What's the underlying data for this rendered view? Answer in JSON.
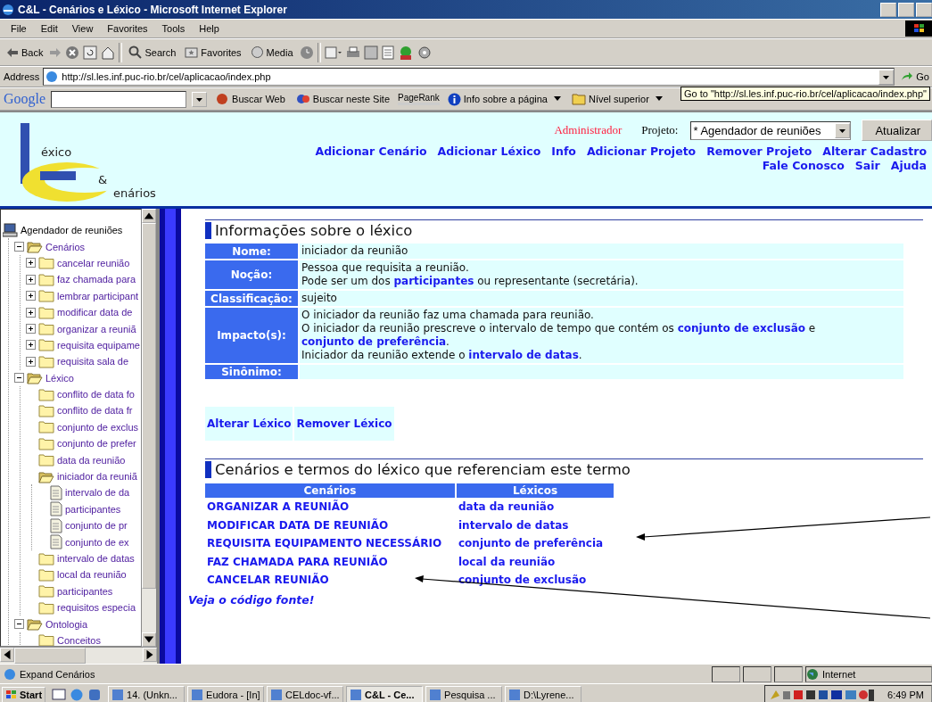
{
  "window": {
    "title": "C&L - Cenários e Léxico - Microsoft Internet Explorer"
  },
  "menu": [
    "File",
    "Edit",
    "View",
    "Favorites",
    "Tools",
    "Help"
  ],
  "toolbar": {
    "back": "Back",
    "search": "Search",
    "favorites": "Favorites",
    "media": "Media"
  },
  "address_bar": {
    "label": "Address",
    "url": "http://sl.les.inf.puc-rio.br/cel/aplicacao/index.php",
    "go": "Go"
  },
  "google_bar": {
    "logo": "Google",
    "buscar_web": "Buscar Web",
    "buscar_site": "Buscar neste Site",
    "pagerank": "PageRank",
    "info": "Info sobre a página",
    "nivel": "Nível superior"
  },
  "tooltip": "Go to \"http://sl.les.inf.puc-rio.br/cel/aplicacao/index.php\"",
  "header": {
    "logo": {
      "line1": "éxico",
      "amp": "&",
      "line2": "enários"
    },
    "role": "Administrador",
    "project_label": "Projeto:",
    "project": "* Agendador de reuniões",
    "update_button": "Atualizar",
    "nav": [
      [
        "Adicionar Cenário",
        "Adicionar Léxico",
        "Info",
        "Adicionar Projeto",
        "Remover Projeto",
        "Alterar Cadastro"
      ],
      [
        "Fale Conosco",
        "Sair",
        "Ajuda"
      ]
    ]
  },
  "tree": {
    "label": "Agendador de reuniões",
    "kind": "computer",
    "children": [
      {
        "label": "Cenários",
        "kind": "folder",
        "expanded": true,
        "children": [
          {
            "label": "cancelar reunião",
            "kind": "folder",
            "expanded": false
          },
          {
            "label": "faz chamada para",
            "kind": "folder",
            "expanded": false
          },
          {
            "label": "lembrar participant",
            "kind": "folder",
            "expanded": false
          },
          {
            "label": "modificar data de",
            "kind": "folder",
            "expanded": false
          },
          {
            "label": "organizar a reuniã",
            "kind": "folder",
            "expanded": false
          },
          {
            "label": "requisita equipame",
            "kind": "folder",
            "expanded": false
          },
          {
            "label": "requisita sala de",
            "kind": "folder",
            "expanded": false
          }
        ]
      },
      {
        "label": "Léxico",
        "kind": "folder",
        "expanded": true,
        "children": [
          {
            "label": "conflito de data fo",
            "kind": "folder"
          },
          {
            "label": "conflito de data fr",
            "kind": "folder"
          },
          {
            "label": "conjunto de exclus",
            "kind": "folder"
          },
          {
            "label": "conjunto de prefer",
            "kind": "folder"
          },
          {
            "label": "data da reunião",
            "kind": "folder"
          },
          {
            "label": "iniciador da reuniã",
            "kind": "folder",
            "children": [
              {
                "label": "intervalo de da",
                "kind": "document"
              },
              {
                "label": "participantes",
                "kind": "document"
              },
              {
                "label": "conjunto de pr",
                "kind": "document"
              },
              {
                "label": "conjunto de ex",
                "kind": "document"
              }
            ]
          },
          {
            "label": "intervalo de datas",
            "kind": "folder"
          },
          {
            "label": "local da reunião",
            "kind": "folder"
          },
          {
            "label": "participantes",
            "kind": "folder"
          },
          {
            "label": "requisitos especia",
            "kind": "folder"
          }
        ]
      },
      {
        "label": "Ontologia",
        "kind": "folder",
        "expanded": true,
        "children": [
          {
            "label": "Conceitos",
            "kind": "folder"
          }
        ]
      }
    ]
  },
  "lexicon": {
    "heading": "Informações sobre o léxico",
    "fields": [
      {
        "label": "Nome:",
        "lines": [
          [
            {
              "text": "iniciador da reunião",
              "link": false
            }
          ]
        ]
      },
      {
        "label": "Noção:",
        "lines": [
          [
            {
              "text": "Pessoa que requisita a reunião.",
              "link": false
            }
          ],
          [
            {
              "text": "Pode ser um dos ",
              "link": false
            },
            {
              "text": "participantes",
              "link": true
            },
            {
              "text": " ou representante (secretária).",
              "link": false
            }
          ]
        ]
      },
      {
        "label": "Classificação:",
        "lines": [
          [
            {
              "text": "sujeito",
              "link": false
            }
          ]
        ]
      },
      {
        "label": "Impacto(s):",
        "lines": [
          [
            {
              "text": "O iniciador da reunião faz uma chamada para reunião.",
              "link": false
            }
          ],
          [
            {
              "text": "O iniciador da reunião prescreve o intervalo de tempo que contém os ",
              "link": false
            },
            {
              "text": "conjunto de exclusão",
              "link": true
            },
            {
              "text": " e ",
              "link": false
            },
            {
              "text": "conjunto de preferência",
              "link": true
            },
            {
              "text": ".",
              "link": false
            }
          ],
          [
            {
              "text": "Iniciador da reunião extende o ",
              "link": false
            },
            {
              "text": "intervalo de datas",
              "link": true
            },
            {
              "text": ".",
              "link": false
            }
          ]
        ]
      },
      {
        "label": "Sinônimo:"
      }
    ],
    "actions": [
      "Alterar Léxico",
      "Remover Léxico"
    ]
  },
  "references": {
    "heading": "Cenários e termos do léxico que referenciam este termo",
    "columns": [
      "Cenários",
      "Léxicos"
    ],
    "rows": [
      [
        "ORGANIZAR A REUNIÃO",
        "data da reunião"
      ],
      [
        "MODIFICAR DATA DE REUNIÃO",
        "intervalo de datas"
      ],
      [
        "REQUISITA EQUIPAMENTO NECESSÁRIO",
        "conjunto de preferência"
      ],
      [
        "FAZ CHAMADA PARA REUNIÃO",
        "local da reunião"
      ],
      [
        "CANCELAR REUNIÃO",
        "conjunto de exclusão"
      ]
    ]
  },
  "source_link": "Veja o código fonte!",
  "status_bar": {
    "text": "Expand Cenários",
    "zone": "Internet"
  },
  "taskbar": {
    "start": "Start",
    "tasks": [
      {
        "label": "14. (Unkn...",
        "selected": false
      },
      {
        "label": "Eudora - [In]",
        "selected": false
      },
      {
        "label": "CELdoc-vf...",
        "selected": false
      },
      {
        "label": "C&L - Ce...",
        "selected": true
      },
      {
        "label": "Pesquisa ...",
        "selected": false
      },
      {
        "label": "D:\\Lyrene...",
        "selected": false
      }
    ],
    "clock": "6:49 PM"
  }
}
